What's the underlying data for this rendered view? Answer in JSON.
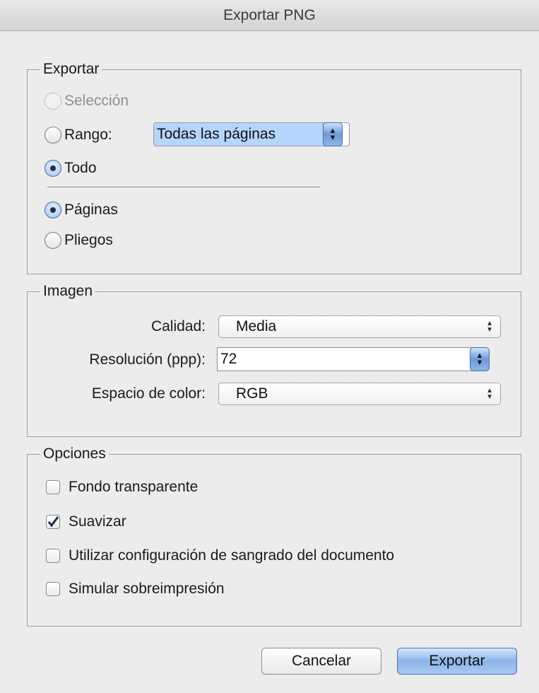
{
  "window": {
    "title": "Exportar PNG"
  },
  "exportar": {
    "legend": "Exportar",
    "seleccion_label": "Selección",
    "rango_label": "Rango:",
    "rango_value": "Todas las páginas",
    "todo_label": "Todo",
    "paginas_label": "Páginas",
    "pliegos_label": "Pliegos"
  },
  "imagen": {
    "legend": "Imagen",
    "calidad_label": "Calidad:",
    "calidad_value": "Media",
    "resolucion_label": "Resolución (ppp):",
    "resolucion_value": "72",
    "espacio_label": "Espacio de color:",
    "espacio_value": "RGB"
  },
  "opciones": {
    "legend": "Opciones",
    "items": [
      {
        "label": "Fondo transparente",
        "checked": false
      },
      {
        "label": "Suavizar",
        "checked": true
      },
      {
        "label": "Utilizar configuración de sangrado del documento",
        "checked": false
      },
      {
        "label": "Simular sobreimpresión",
        "checked": false
      }
    ]
  },
  "buttons": {
    "cancel": "Cancelar",
    "export": "Exportar"
  },
  "colors": {
    "accent": "#8cb4ea",
    "selection": "#b5d5fd"
  }
}
